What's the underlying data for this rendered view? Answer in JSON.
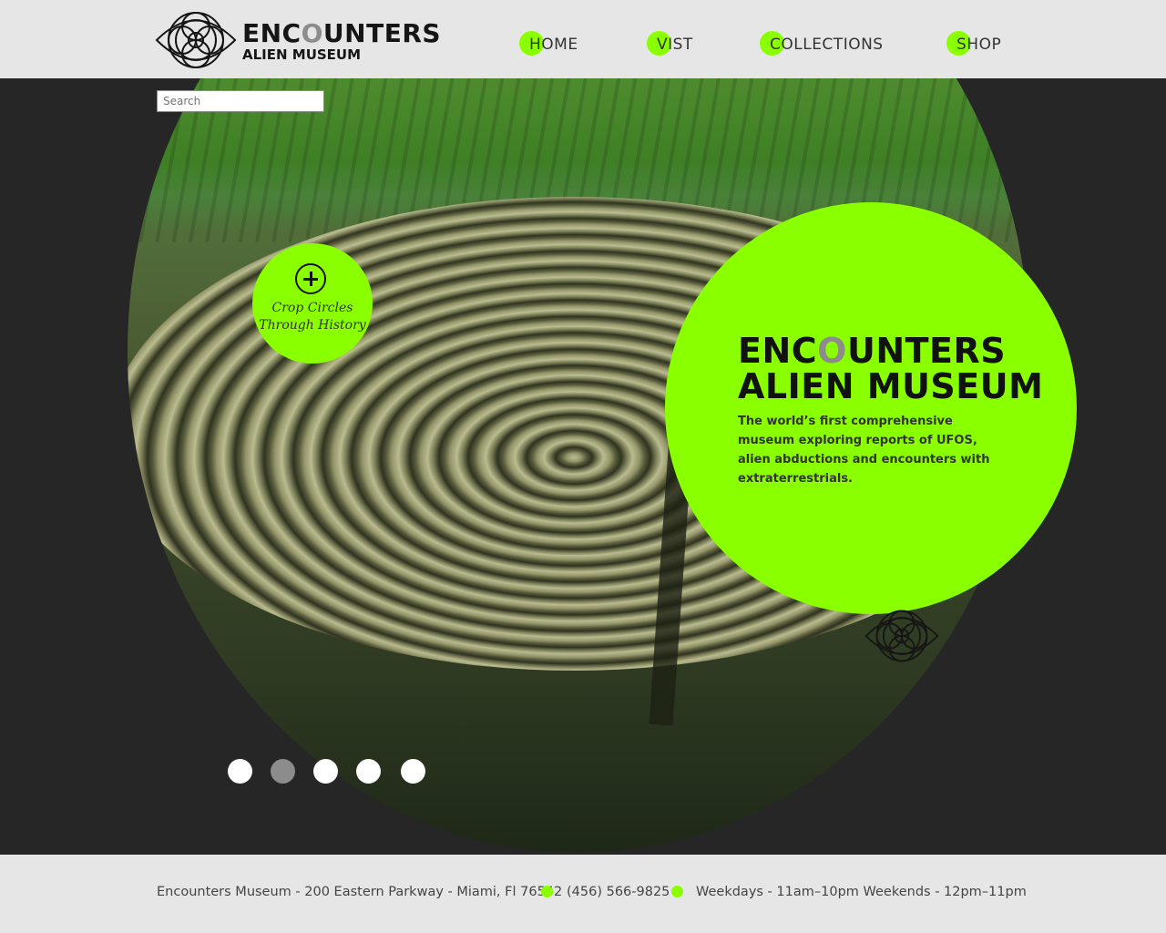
{
  "brand": {
    "title_pre": "ENC",
    "title_o": "O",
    "title_post": "UNTERS",
    "subtitle": "ALIEN MUSEUM",
    "accent_color": "#8aff00"
  },
  "nav": {
    "items": [
      {
        "label": "HOME"
      },
      {
        "label": "VIST"
      },
      {
        "label": "COLLECTIONS"
      },
      {
        "label": "SHOP"
      }
    ]
  },
  "search": {
    "placeholder": "Search",
    "value": ""
  },
  "feature": {
    "icon": "plus-icon",
    "line1": "Crop Circles",
    "line2": "Through History"
  },
  "hero": {
    "title_pre": "ENC",
    "title_o": "O",
    "title_post": "UNTERS",
    "title2": "ALIEN MUSEUM",
    "description": "The world’s first comprehensive museum exploring reports of UFOS, alien abductions and encounters with extraterrestrials."
  },
  "slider": {
    "count": 5,
    "active_index": 1
  },
  "footer": {
    "address": "Encounters Museum - 200 Eastern Parkway - Miami, Fl 76542",
    "phone": "(456) 566-9825",
    "hours": "Weekdays - 11am–10pm Weekends - 12pm–11pm"
  }
}
